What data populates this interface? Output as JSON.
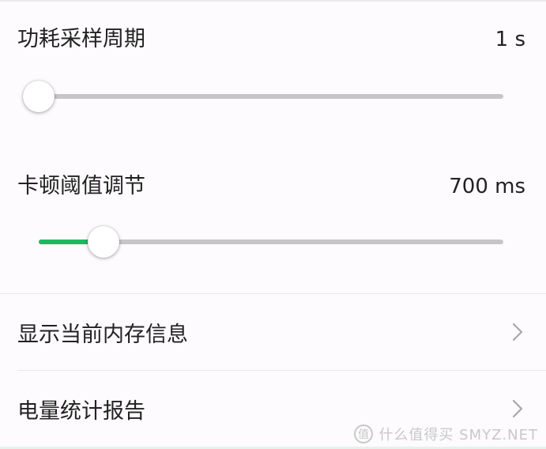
{
  "settings": {
    "power_sampling": {
      "label": "功耗采样周期",
      "value": "1 s",
      "slider_position": 0.0
    },
    "stutter_threshold": {
      "label": "卡顿阈值调节",
      "value": "700 ms",
      "slider_position": 0.14
    }
  },
  "nav": {
    "memory_info": {
      "label": "显示当前内存信息",
      "icon": "chevron-right-icon"
    },
    "power_report": {
      "label": "电量统计报告",
      "icon": "chevron-right-icon"
    }
  },
  "colors": {
    "accent": "#1db95f",
    "track": "#c6c6c6",
    "background": "#fdfbfd"
  },
  "watermark": {
    "text": "什么值得买 SMYZ.NET"
  }
}
